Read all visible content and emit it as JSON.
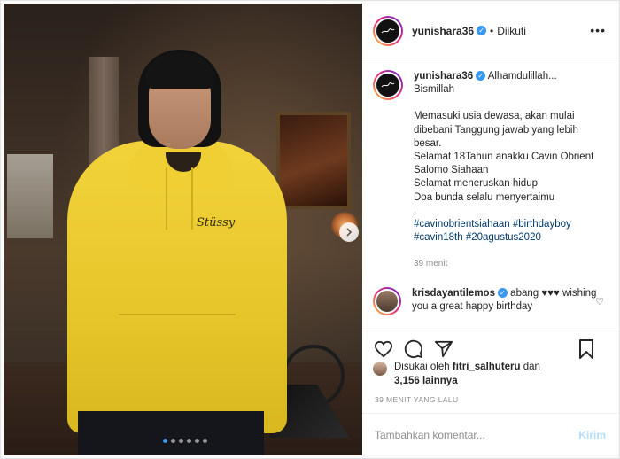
{
  "post": {
    "carousel": {
      "slide_count": 6,
      "active_index": 0,
      "hoodie_logo": "Stüssy"
    },
    "header": {
      "username": "yunishara36",
      "separator": "•",
      "follow_status": "Diikuti",
      "more_icon": "more-horizontal-icon"
    },
    "caption": {
      "username": "yunishara36",
      "line1": "Alhamdulillah...",
      "line2": "Bismillah",
      "paragraph": "Memasuki usia dewasa, akan mulai dibebani Tanggung jawab yang lebih besar.",
      "line3": "Selamat 18Tahun anakku Cavin Obrient Salomo Siahaan",
      "line4": "Selamat meneruskan hidup",
      "line5": "Doa bunda selalu menyertaimu",
      "line6": ".",
      "hashtags": "#cavinobrientsiahaan #birthdayboy #cavin18th #20agustus2020",
      "time": "39 menit"
    },
    "comment": {
      "username": "krisdayantilemos",
      "text": "abang ♥♥♥ wishing you a great happy birthday"
    },
    "likes": {
      "prefix": "Disukai oleh",
      "user": "fitri_salhuteru",
      "mid": "dan",
      "count": "3,156 lainnya"
    },
    "timestamp": "39 MENIT YANG LALU",
    "add_comment": {
      "placeholder": "Tambahkan komentar...",
      "post_label": "Kirim"
    },
    "colors": {
      "accent_blue": "#3897f0",
      "hoodie_yellow": "#f2d33a",
      "post_button": "#b2dffc",
      "hashtag": "#00376b"
    }
  }
}
